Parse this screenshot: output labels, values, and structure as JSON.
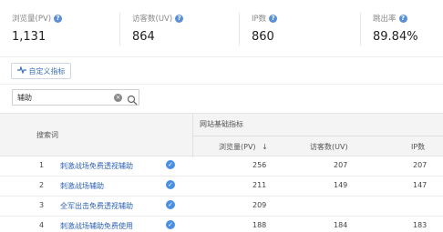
{
  "metrics": [
    {
      "label": "浏览量(PV)",
      "value": "1,131",
      "help": true
    },
    {
      "label": "访客数(UV)",
      "value": "864",
      "help": true
    },
    {
      "label": "IP数",
      "value": "860",
      "help": true
    },
    {
      "label": "跳出率",
      "value": "89.84%",
      "help": true
    }
  ],
  "toolbar": {
    "custom_metrics_label": "自定义指标",
    "custom_metrics_icon": "pulse-icon"
  },
  "search": {
    "value": "辅助",
    "clear_icon": "clear-icon",
    "search_icon": "search-icon"
  },
  "table": {
    "group_header": "网站基础指标",
    "columns": {
      "keyword": "搜索词",
      "pv": "浏览量(PV)",
      "uv": "访客数(UV)",
      "ip": "IP数"
    },
    "sort_indicator": "↓",
    "rows": [
      {
        "index": "1",
        "keyword": "刺激战场免费透视辅助",
        "pv": "256",
        "uv": "207",
        "ip": "207"
      },
      {
        "index": "2",
        "keyword": "刺激战场辅助",
        "pv": "211",
        "uv": "149",
        "ip": "147"
      },
      {
        "index": "3",
        "keyword": "全军出击免费透视辅助",
        "pv": "209",
        "uv": "",
        "ip": ""
      },
      {
        "index": "4",
        "keyword": "刺激战场辅助免费使用",
        "pv": "188",
        "uv": "184",
        "ip": "183"
      }
    ]
  },
  "colors": {
    "accent": "#2f63b8",
    "help_icon": "#5a8fd6",
    "badge": "#4a90e2",
    "header_bg": "#f4f4f4"
  }
}
